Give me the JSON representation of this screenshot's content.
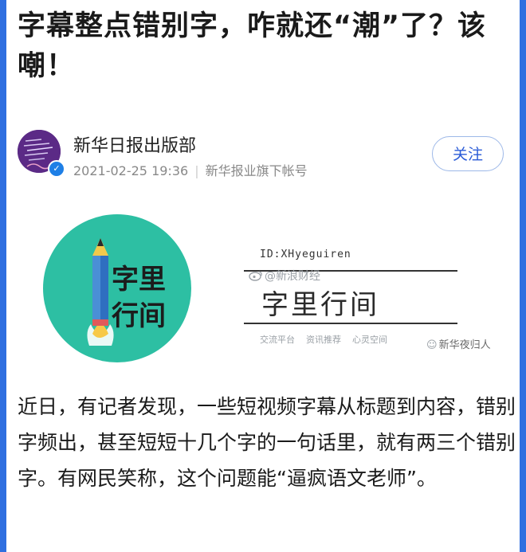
{
  "article": {
    "title": "字幕整点错别字，咋就还“潮”了？该嘲！",
    "body": "近日，有记者发现，一些短视频字幕从标题到内容，错别字频出，甚至短短十几个字的一句话里，就有两三个错别字。有网民笑称，这个问题能“逼疯语文老师”。"
  },
  "author": {
    "name": "新华日报出版部",
    "date": "2021-02-25 19:36",
    "account_type": "新华报业旗下帐号",
    "follow_label": "关注",
    "avatar_color": "#5b2a86",
    "verified_color": "#1e7fe6"
  },
  "banner": {
    "circle_line1": "字里",
    "circle_line2": "行间",
    "id_text": "ID:XHyeguiren",
    "watermark": "@新浪财经",
    "title": "字里行间",
    "tags": [
      "交流平台",
      "资讯推荐",
      "心灵空间"
    ],
    "source": "新华夜归人",
    "circle_color": "#2dbfa3"
  },
  "colors": {
    "frame": "#2f6fe0",
    "accent": "#2a5bd7"
  }
}
